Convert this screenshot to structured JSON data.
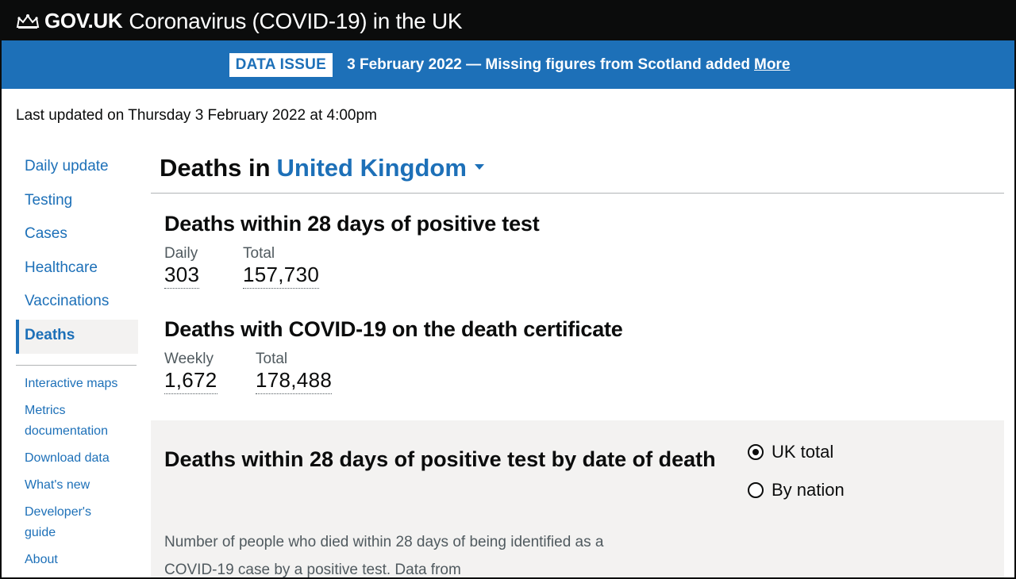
{
  "header": {
    "brand": "GOV.UK",
    "service_title": "Coronavirus (COVID-19) in the UK",
    "crown_icon": "crown-icon"
  },
  "banner": {
    "tag": "DATA ISSUE",
    "message": "3 February 2022 — Missing figures from Scotland added",
    "link": "More",
    "color": "#1d70b8"
  },
  "last_updated": "Last updated on Thursday 3 February 2022 at 4:00pm",
  "sidebar": {
    "items": [
      {
        "label": "Daily update"
      },
      {
        "label": "Testing"
      },
      {
        "label": "Cases"
      },
      {
        "label": "Healthcare"
      },
      {
        "label": "Vaccinations"
      },
      {
        "label": "Deaths"
      }
    ],
    "active": "Deaths",
    "secondary": [
      {
        "label": "Interactive maps"
      },
      {
        "label": "Metrics documentation"
      },
      {
        "label": "Download data"
      },
      {
        "label": "What's new"
      },
      {
        "label": "Developer's guide"
      },
      {
        "label": "About"
      }
    ]
  },
  "main": {
    "heading_prefix": "Deaths in",
    "area": "United Kingdom",
    "cards": [
      {
        "title": "Deaths within 28 days of positive test",
        "metrics": [
          {
            "label": "Daily",
            "value": "303"
          },
          {
            "label": "Total",
            "value": "157,730"
          }
        ]
      },
      {
        "title": "Deaths with COVID-19 on the death certificate",
        "metrics": [
          {
            "label": "Weekly",
            "value": "1,672"
          },
          {
            "label": "Total",
            "value": "178,488"
          }
        ]
      }
    ],
    "panel": {
      "title": "Deaths within 28 days of positive test by date of death",
      "description": "Number of people who died within 28 days of being identified as a COVID-19 case by a positive test. Data from",
      "options": [
        {
          "label": "UK total",
          "checked": true
        },
        {
          "label": "By nation",
          "checked": false
        }
      ]
    }
  },
  "colors": {
    "header_bg": "#0b0c0c",
    "link": "#1d70b8",
    "panel_bg": "#f3f2f1"
  }
}
